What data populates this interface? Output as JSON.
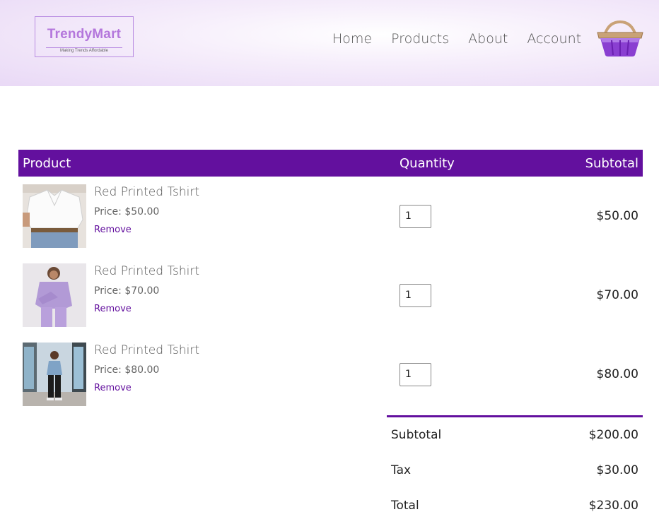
{
  "brand": {
    "name": "TrendyMart",
    "tagline": "Making Trends Affordable"
  },
  "nav": {
    "items": [
      "Home",
      "Products",
      "About",
      "Account"
    ],
    "cart_icon": "shopping-basket-icon"
  },
  "table": {
    "headers": {
      "product": "Product",
      "quantity": "Quantity",
      "subtotal": "Subtotal"
    },
    "items": [
      {
        "name": "Red Printed Tshirt",
        "price": "Price: $50.00",
        "remove": "Remove",
        "quantity": "1",
        "subtotal": "$50.00",
        "image": "white-shirt-photo"
      },
      {
        "name": "Red Printed Tshirt",
        "price": "Price: $70.00",
        "remove": "Remove",
        "quantity": "1",
        "subtotal": "$70.00",
        "image": "lavender-outfit-photo"
      },
      {
        "name": "Red Printed Tshirt",
        "price": "Price: $80.00",
        "remove": "Remove",
        "quantity": "1",
        "subtotal": "$80.00",
        "image": "street-denim-outfit-photo"
      }
    ]
  },
  "totals": {
    "subtotal_label": "Subtotal",
    "subtotal_value": "$200.00",
    "tax_label": "Tax",
    "tax_value": "$30.00",
    "total_label": "Total",
    "total_value": "$230.00"
  },
  "colors": {
    "accent": "#63109e",
    "logo": "#b477dc",
    "header_bg": "#e9d9f6"
  }
}
